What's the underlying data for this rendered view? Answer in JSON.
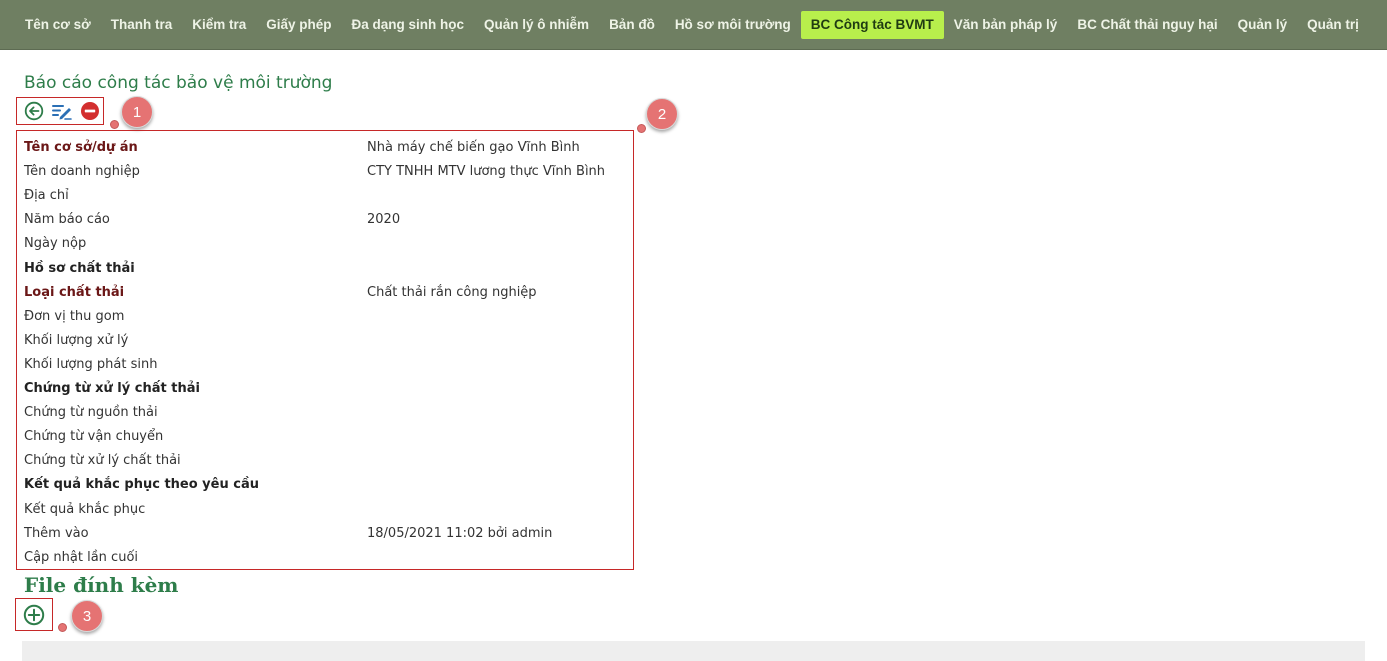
{
  "nav": {
    "items": [
      {
        "label": "Tên cơ sở",
        "active": false
      },
      {
        "label": "Thanh tra",
        "active": false
      },
      {
        "label": "Kiểm tra",
        "active": false
      },
      {
        "label": "Giấy phép",
        "active": false
      },
      {
        "label": "Đa dạng sinh học",
        "active": false
      },
      {
        "label": "Quản lý ô nhiễm",
        "active": false
      },
      {
        "label": "Bản đồ",
        "active": false
      },
      {
        "label": "Hồ sơ môi trường",
        "active": false
      },
      {
        "label": "BC Công tác BVMT",
        "active": true
      },
      {
        "label": "Văn bản pháp lý",
        "active": false
      },
      {
        "label": "BC Chất thải nguy hại",
        "active": false
      },
      {
        "label": "Quản lý",
        "active": false
      },
      {
        "label": "Quản trị",
        "active": false
      }
    ]
  },
  "page": {
    "title": "Báo cáo công tác bảo vệ môi trường"
  },
  "toolbar": {
    "icons": [
      "back-circle-icon",
      "edit-lines-icon",
      "delete-circle-icon"
    ]
  },
  "callouts": [
    "1",
    "2",
    "3"
  ],
  "details": [
    {
      "label": "Tên cơ sở/dự án",
      "value": "Nhà máy chế biến gạo Vĩnh Bình",
      "style": "required"
    },
    {
      "label": "Tên doanh nghiệp",
      "value": "CTY TNHH MTV lương thực Vĩnh Bình",
      "style": "normal"
    },
    {
      "label": "Địa chỉ",
      "value": "",
      "style": "normal"
    },
    {
      "label": "Năm báo cáo",
      "value": "2020",
      "style": "normal"
    },
    {
      "label": "Ngày nộp",
      "value": "",
      "style": "normal"
    },
    {
      "label": "Hồ sơ chất thải",
      "value": "",
      "style": "section"
    },
    {
      "label": "Loại chất thải",
      "value": "Chất thải rắn công nghiệp",
      "style": "required"
    },
    {
      "label": "Đơn vị thu gom",
      "value": "",
      "style": "normal"
    },
    {
      "label": "Khối lượng xử lý",
      "value": "",
      "style": "normal"
    },
    {
      "label": "Khối lượng phát sinh",
      "value": "",
      "style": "normal"
    },
    {
      "label": "Chứng từ xử lý chất thải",
      "value": "",
      "style": "section"
    },
    {
      "label": "Chứng từ nguồn thải",
      "value": "",
      "style": "normal"
    },
    {
      "label": "Chứng từ vận chuyển",
      "value": "",
      "style": "normal"
    },
    {
      "label": "Chứng từ xử lý chất thải",
      "value": "",
      "style": "normal"
    },
    {
      "label": "Kết quả khắc phục theo yêu cầu",
      "value": "",
      "style": "section"
    },
    {
      "label": "Kết quả khắc phục",
      "value": "",
      "style": "normal"
    },
    {
      "label": "Thêm vào",
      "value": "18/05/2021 11:02 bởi admin",
      "style": "normal"
    },
    {
      "label": "Cập nhật lần cuối",
      "value": "",
      "style": "normal"
    }
  ],
  "attachments": {
    "title": "File đính kèm",
    "add_icon": "add-circle-icon"
  },
  "colors": {
    "nav_bg": "#6f7f62",
    "nav_active": "#b8ef4c",
    "title_green": "#2e7d4a",
    "highlight_red": "#c62828",
    "callout": "#e57373"
  }
}
